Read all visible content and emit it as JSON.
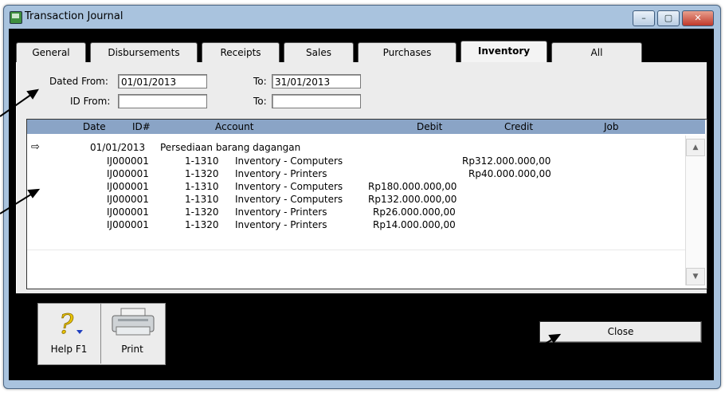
{
  "window": {
    "title": "Transaction Journal",
    "minimize": "–",
    "maximize": "▢",
    "close": "✕"
  },
  "tabs": [
    {
      "label": "General"
    },
    {
      "label": "Disbursements"
    },
    {
      "label": "Receipts"
    },
    {
      "label": "Sales"
    },
    {
      "label": "Purchases"
    },
    {
      "label": "Inventory",
      "active": true
    },
    {
      "label": "All"
    }
  ],
  "filters": {
    "dated_from_label": "Dated From:",
    "dated_from_value": "01/01/2013",
    "dated_to_label": "To:",
    "dated_to_value": "31/01/2013",
    "id_from_label": "ID From:",
    "id_from_value": "",
    "id_to_label": "To:",
    "id_to_value": ""
  },
  "grid": {
    "columns": [
      "Date",
      "ID#",
      "Account",
      "Debit",
      "Credit",
      "Job"
    ],
    "group": {
      "marker": "⇨",
      "date": "01/01/2013",
      "memo": "Persediaan barang dagangan"
    },
    "rows": [
      {
        "id": "IJ000001",
        "account_no": "1-1310",
        "account": "Inventory - Computers",
        "debit": "",
        "credit": "Rp312.000.000,00"
      },
      {
        "id": "IJ000001",
        "account_no": "1-1320",
        "account": "Inventory - Printers",
        "debit": "",
        "credit": "Rp40.000.000,00"
      },
      {
        "id": "IJ000001",
        "account_no": "1-1310",
        "account": "Inventory - Computers",
        "debit": "Rp180.000.000,00",
        "credit": ""
      },
      {
        "id": "IJ000001",
        "account_no": "1-1310",
        "account": "Inventory - Computers",
        "debit": "Rp132.000.000,00",
        "credit": ""
      },
      {
        "id": "IJ000001",
        "account_no": "1-1320",
        "account": "Inventory - Printers",
        "debit": "Rp26.000.000,00",
        "credit": ""
      },
      {
        "id": "IJ000001",
        "account_no": "1-1320",
        "account": "Inventory - Printers",
        "debit": "Rp14.000.000,00",
        "credit": ""
      }
    ]
  },
  "toolbar": {
    "help_label": "Help F1",
    "print_label": "Print"
  },
  "close_label": "Close"
}
